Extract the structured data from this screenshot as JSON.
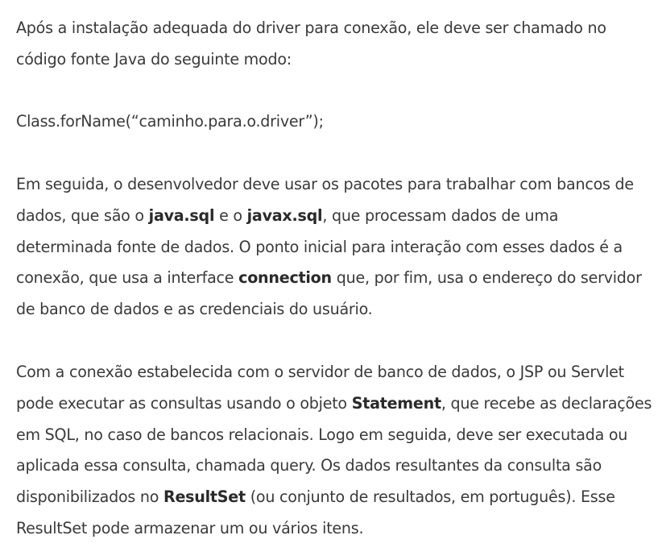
{
  "article": {
    "p1": {
      "line1": "Após a instalação adequada do driver para conexão, ele deve ser chamado no",
      "line2": "código fonte Java do seguinte modo:"
    },
    "code_line": "Class.forName(“caminho.para.o.driver”);",
    "p3": {
      "line1": "Em seguida, o desenvolvedor deve usar os pacotes para trabalhar com bancos de",
      "line2_a": "dados, que são o ",
      "line2_b1": "java.sql",
      "line2_b": " e o ",
      "line2_b2": "javax.sql",
      "line2_c": ", que processam dados de uma",
      "line3": "determinada fonte de dados. O ponto inicial para interação com esses dados é a",
      "line4_a": "conexão, que usa a interface ",
      "line4_b1": "connection",
      "line4_c": " que, por fim, usa o endereço do servidor",
      "line5": "de banco de dados e as credenciais do usuário."
    },
    "p4": {
      "line1": "Com a conexão estabelecida com o servidor de banco de dados, o JSP ou Servlet",
      "line2_a": "pode executar as consultas usando o objeto ",
      "line2_b1": "Statement",
      "line2_c": ", que recebe as declarações",
      "line3": "em SQL, no caso de bancos relacionais. Logo em seguida, deve ser executada ou",
      "line4": "aplicada essa consulta, chamada query. Os dados resultantes da consulta são",
      "line5_a": "disponibilizados no ",
      "line5_b1": "ResultSet",
      "line5_c": " (ou conjunto de resultados, em português). Esse",
      "line6": "ResultSet pode armazenar um ou vários itens."
    }
  }
}
